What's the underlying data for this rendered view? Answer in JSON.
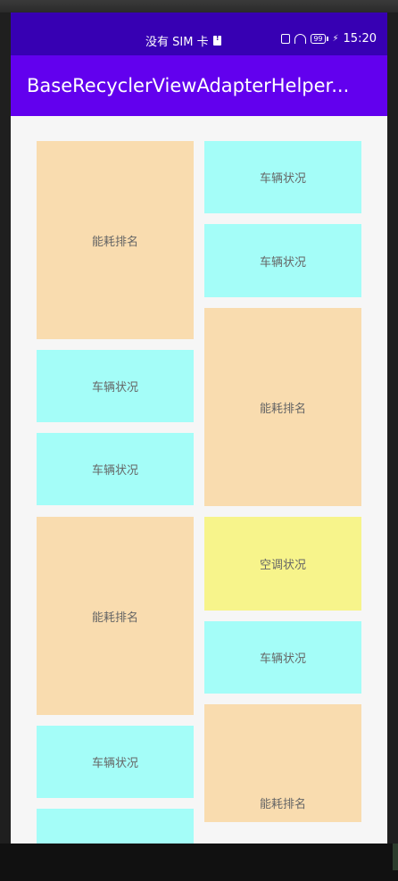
{
  "status_bar": {
    "carrier": "没有 SIM 卡",
    "battery": "99",
    "time": "15:20"
  },
  "app_bar": {
    "title": "BaseRecyclerViewAdapterHelper..."
  },
  "colors": {
    "status_bar": "#3700b3",
    "app_bar": "#6200ee",
    "energy_card": "#f9dcaf",
    "vehicle_card": "#a4fdf8",
    "ac_card": "#f7f48b"
  },
  "grid": {
    "left_column": [
      {
        "label": "能耗排名",
        "type": "energy"
      },
      {
        "label": "车辆状况",
        "type": "vehicle"
      },
      {
        "label": "车辆状况",
        "type": "vehicle"
      },
      {
        "label": "能耗排名",
        "type": "energy"
      },
      {
        "label": "车辆状况",
        "type": "vehicle"
      },
      {
        "label": "",
        "type": "vehicle"
      }
    ],
    "right_column": [
      {
        "label": "车辆状况",
        "type": "vehicle"
      },
      {
        "label": "车辆状况",
        "type": "vehicle"
      },
      {
        "label": "能耗排名",
        "type": "energy"
      },
      {
        "label": "空调状况",
        "type": "ac"
      },
      {
        "label": "车辆状况",
        "type": "vehicle"
      },
      {
        "label": "能耗排名",
        "type": "energy"
      }
    ]
  }
}
